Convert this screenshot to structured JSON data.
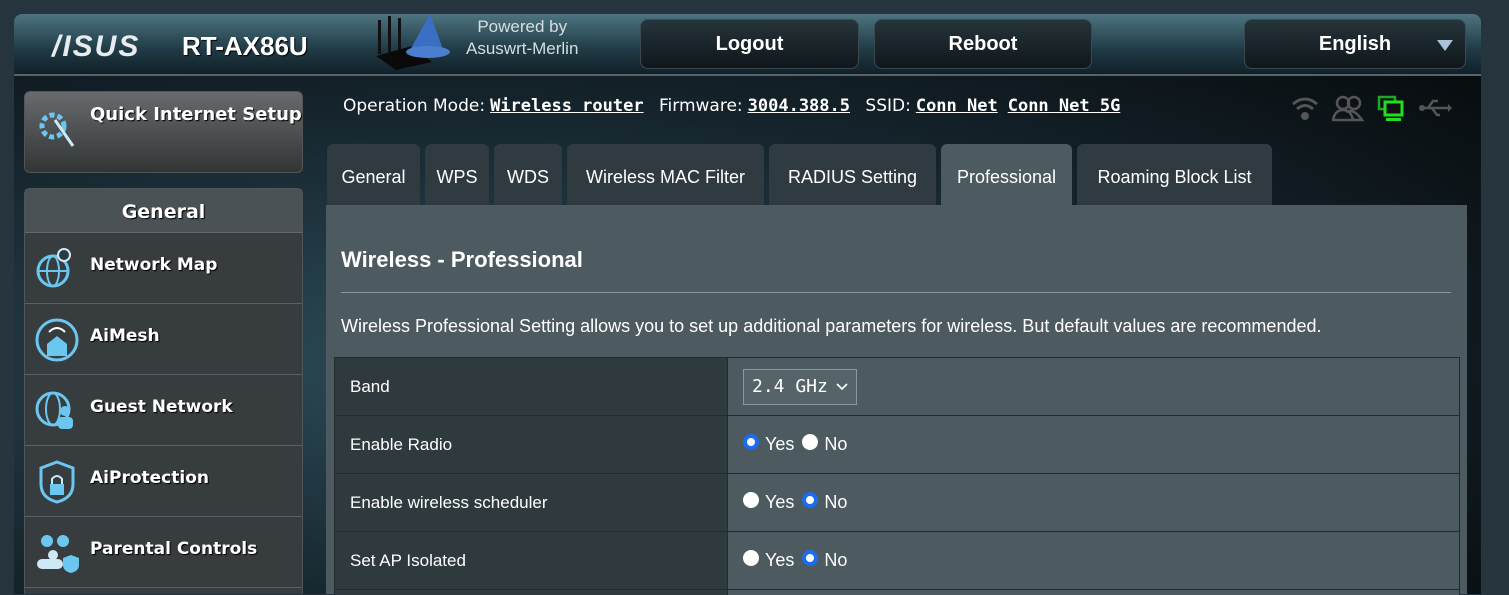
{
  "header": {
    "brand": "/ISUS",
    "model": "RT-AX86U",
    "powered_by": "Powered by",
    "merlin": "Asuswrt-Merlin",
    "logout": "Logout",
    "reboot": "Reboot",
    "language": "English"
  },
  "sidebar": {
    "quick_setup": "Quick Internet Setup",
    "section": "General",
    "items": [
      {
        "label": "Network Map",
        "icon": "globe-pin-icon"
      },
      {
        "label": "AiMesh",
        "icon": "aimesh-icon"
      },
      {
        "label": "Guest Network",
        "icon": "guest-network-icon"
      },
      {
        "label": "AiProtection",
        "icon": "shield-lock-icon"
      },
      {
        "label": "Parental Controls",
        "icon": "parental-controls-icon"
      }
    ]
  },
  "status": {
    "op_mode_label": "Operation Mode:",
    "op_mode": "Wireless router",
    "fw_label": "Firmware:",
    "firmware": "3004.388.5",
    "ssid_label": "SSID:",
    "ssid1": "Conn Net",
    "ssid2": "Conn Net 5G",
    "icons": [
      "wifi-icon",
      "clients-icon",
      "network-icon",
      "usb-icon"
    ],
    "active_icon_color": "#22dd22"
  },
  "tabs": [
    "General",
    "WPS",
    "WDS",
    "Wireless MAC Filter",
    "RADIUS Setting",
    "Professional",
    "Roaming Block List"
  ],
  "active_tab": "Professional",
  "content": {
    "title": "Wireless - Professional",
    "description": "Wireless Professional Setting allows you to set up additional parameters for wireless. But default values are recommended.",
    "rows": [
      {
        "label": "Band",
        "type": "select",
        "value": "2.4 GHz"
      },
      {
        "label": "Enable Radio",
        "type": "radio",
        "yes": "Yes",
        "no": "No",
        "selected": "Yes"
      },
      {
        "label": "Enable wireless scheduler",
        "type": "radio",
        "yes": "Yes",
        "no": "No",
        "selected": "No"
      },
      {
        "label": "Set AP Isolated",
        "type": "radio",
        "yes": "Yes",
        "no": "No",
        "selected": "No"
      }
    ]
  }
}
